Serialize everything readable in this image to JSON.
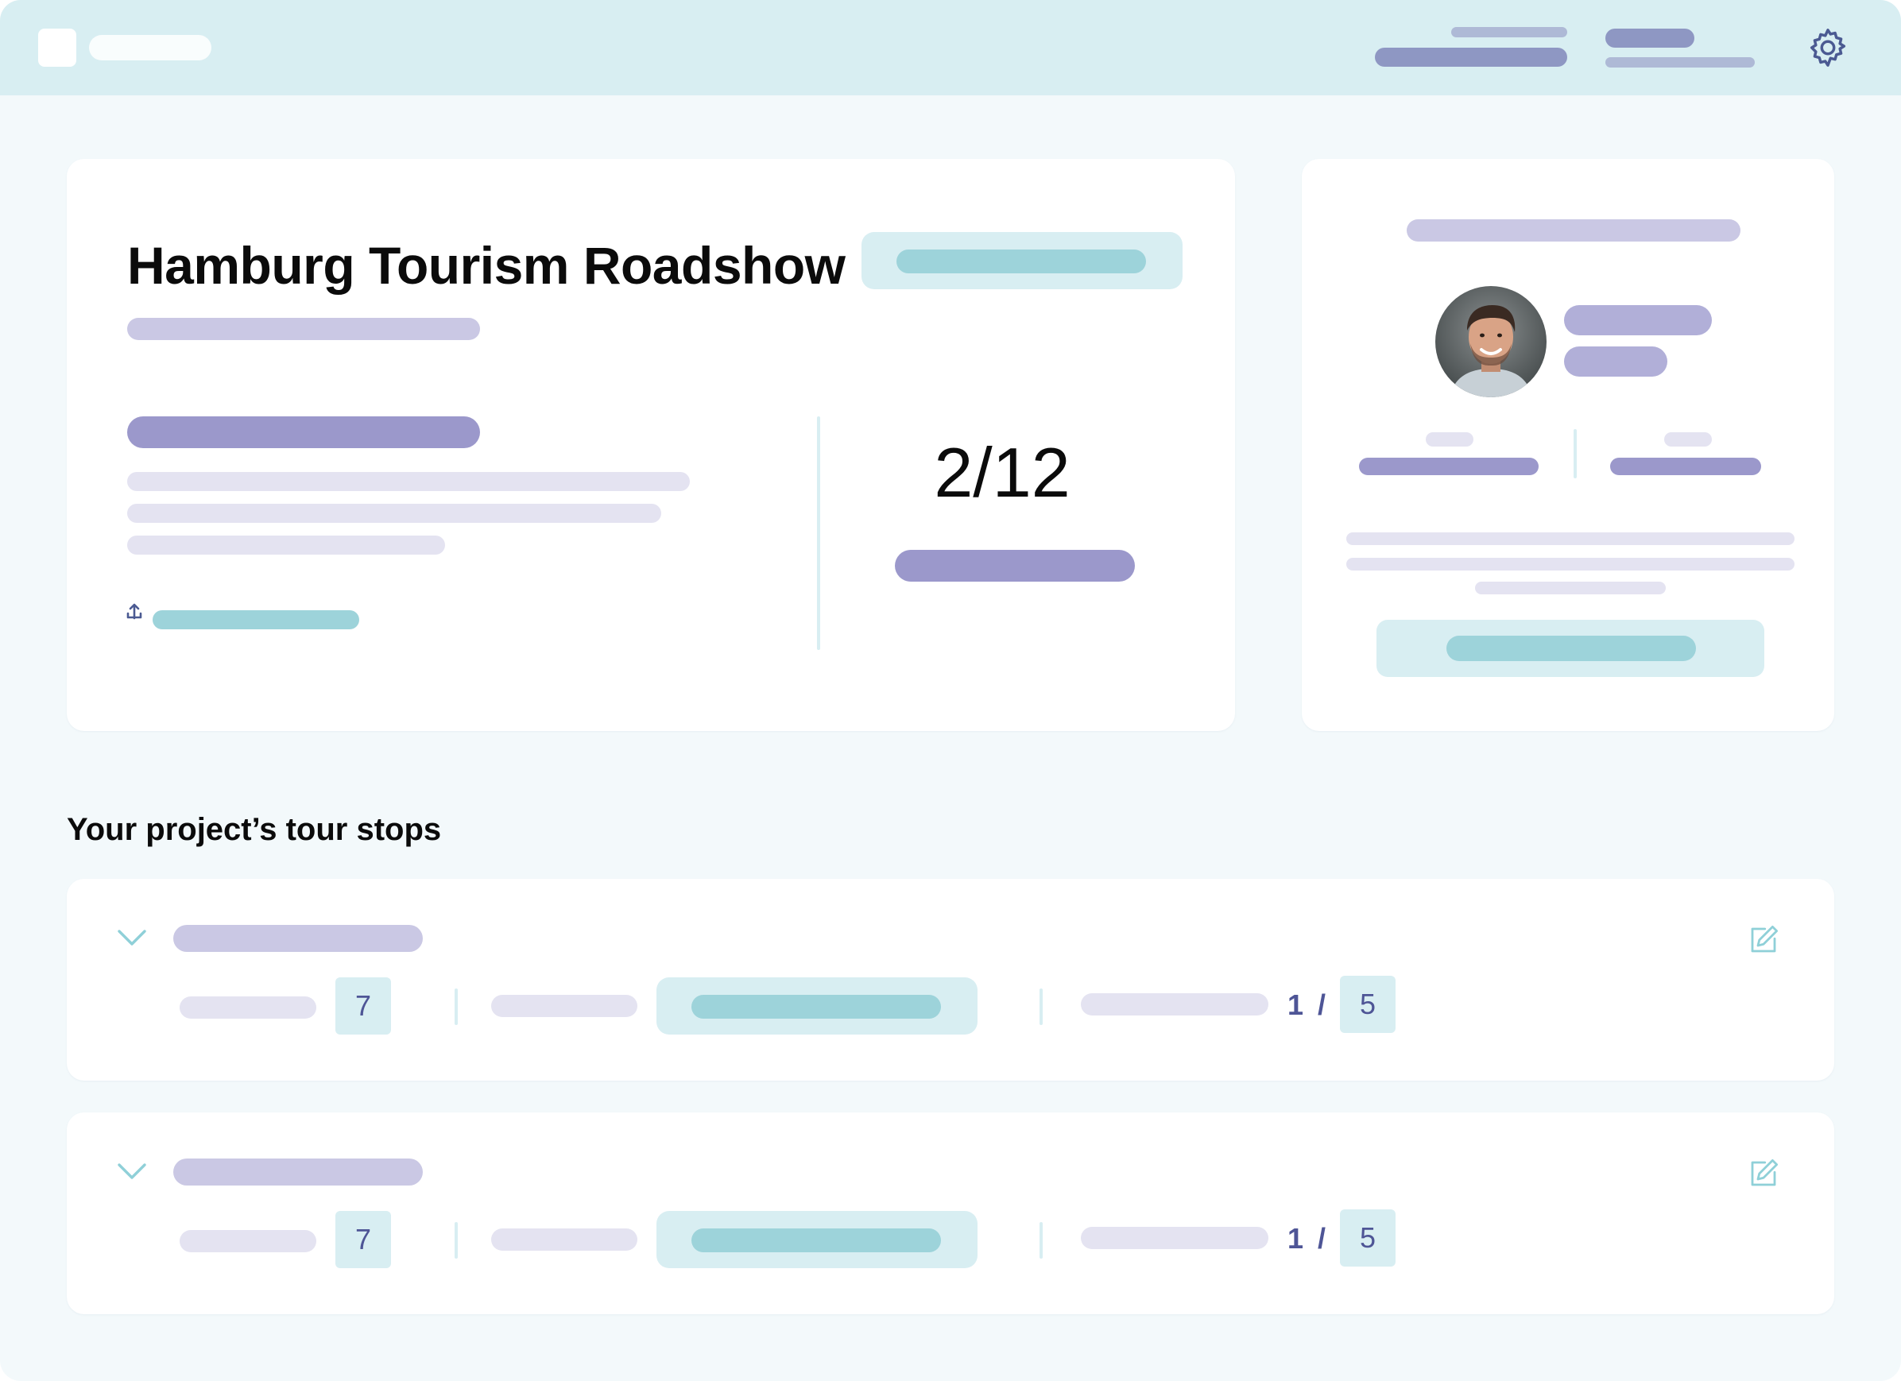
{
  "topbar": {
    "settings_icon": "gear-icon"
  },
  "project": {
    "title": "Hamburg Tourism Roadshow",
    "progress": "2/12",
    "link_icon": "anchor-icon"
  },
  "manager": {
    "avatar": "person-avatar"
  },
  "tour_stops": {
    "heading": "Your project’s tour stops",
    "items": [
      {
        "count": "7",
        "ratio_done": "1",
        "ratio_sep": "/",
        "ratio_total": "5"
      },
      {
        "count": "7",
        "ratio_done": "1",
        "ratio_sep": "/",
        "ratio_total": "5"
      }
    ]
  },
  "colors": {
    "topbar": "#d8eef2",
    "background": "#f3f9fb",
    "accent_teal": "#9dd3da",
    "accent_purple": "#9b98cb",
    "number_text": "#4e5596"
  }
}
